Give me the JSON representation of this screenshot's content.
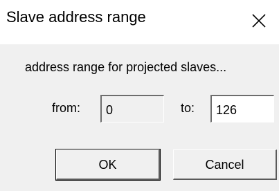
{
  "window": {
    "title": "Slave address range",
    "close_icon": "close-icon"
  },
  "description": "address range for projected slaves...",
  "range": {
    "from_label": "from:",
    "from_value": "0",
    "to_label": "to:",
    "to_value": "126"
  },
  "buttons": {
    "ok_label": "OK",
    "cancel_label": "Cancel"
  }
}
